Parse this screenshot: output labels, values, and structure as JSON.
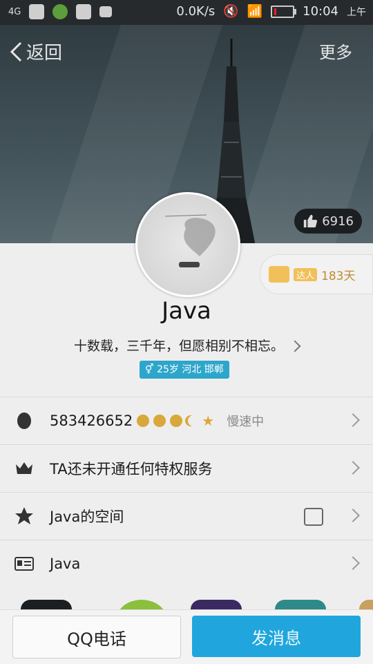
{
  "status_bar": {
    "network": "4G",
    "speed": "0.0K/s",
    "time": "10:04",
    "ampm": "上午"
  },
  "nav": {
    "back_label": "返回",
    "more_label": "更多"
  },
  "hero": {
    "likes": "6916"
  },
  "badge": {
    "tag": "达人",
    "days": "183天"
  },
  "profile": {
    "name": "Java",
    "motto": "十数载，三千年，但愿相别不相忘。",
    "info": "25岁 河北 邯郸"
  },
  "rows": [
    {
      "label": "583426652",
      "status": "慢速中",
      "icon": "penguin-icon"
    },
    {
      "label": "TA还未开通任何特权服务",
      "icon": "crown-icon"
    },
    {
      "label": "Java的空间",
      "icon": "qzone-icon"
    },
    {
      "label": "Java",
      "icon": "id-card-icon"
    }
  ],
  "buttons": {
    "call": "QQ电话",
    "message": "发消息"
  },
  "colors": {
    "accent": "#20a6dc",
    "gold": "#d8a83a"
  }
}
